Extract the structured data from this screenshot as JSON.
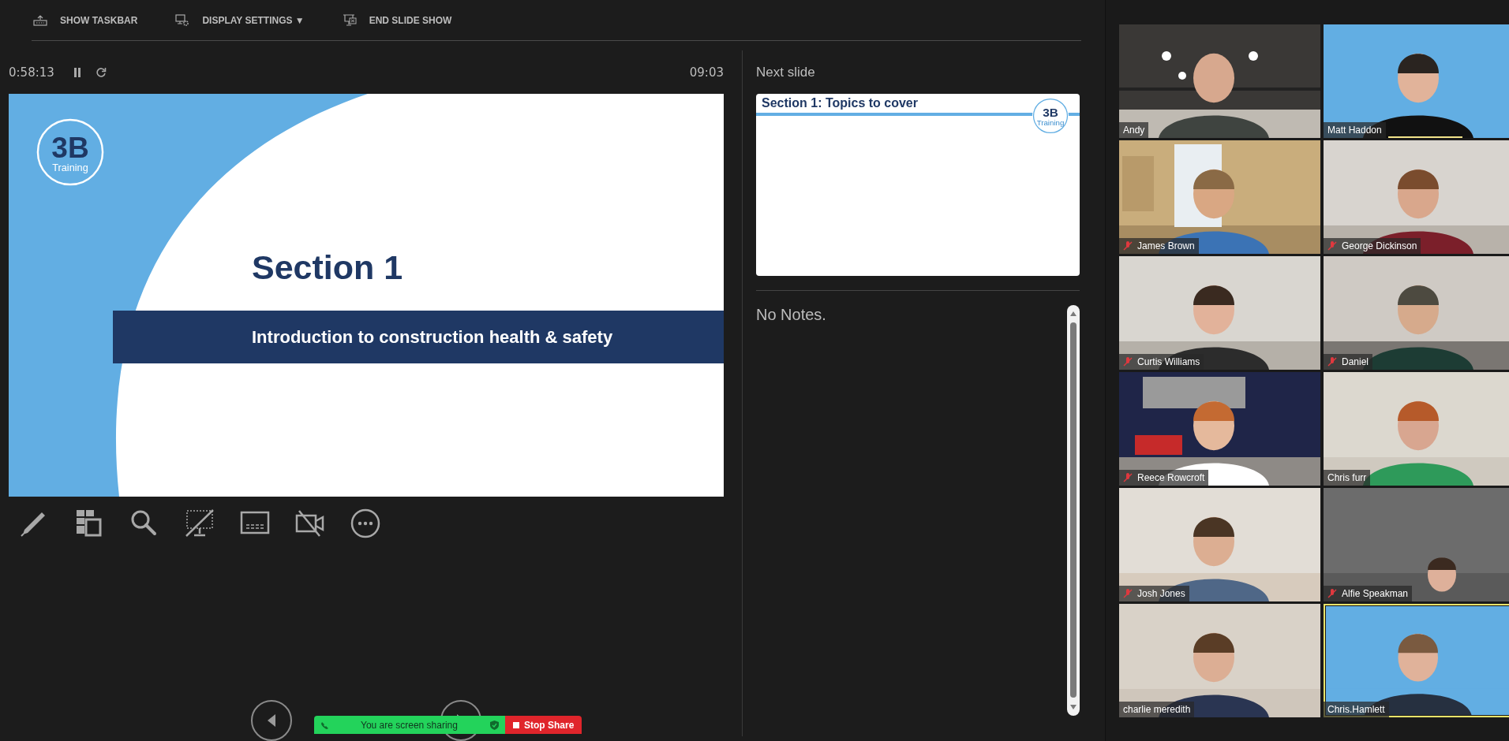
{
  "toolbar": [
    {
      "kind": "taskbar",
      "label": "SHOW TASKBAR"
    },
    {
      "kind": "display",
      "label": "DISPLAY SETTINGS ▼"
    },
    {
      "kind": "end",
      "label": "END SLIDE SHOW"
    }
  ],
  "timer": {
    "elapsed": "0:58:13",
    "clock": "09:03"
  },
  "slide": {
    "logo": {
      "mark": "3B",
      "caption": "Training"
    },
    "title": "Section 1",
    "subtitle": "Introduction to construction health & safety"
  },
  "tools": [
    {
      "kind": "pen"
    },
    {
      "kind": "slides"
    },
    {
      "kind": "zoom"
    },
    {
      "kind": "screen"
    },
    {
      "kind": "subtitles"
    },
    {
      "kind": "camera"
    },
    {
      "kind": "more"
    }
  ],
  "next_slide": {
    "heading": "Next slide",
    "title": "Section 1: Topics to cover",
    "logo": {
      "mark": "3B",
      "caption": "Training"
    }
  },
  "notes": {
    "text": "No Notes."
  },
  "share_bar": {
    "status": "You are screen sharing",
    "stop": "Stop Share"
  },
  "participants": [
    {
      "name": "Andy",
      "muted": false,
      "speaking": false,
      "selected": false
    },
    {
      "name": "Matt Haddon",
      "muted": false,
      "speaking": true,
      "selected": false
    },
    {
      "name": "James Brown",
      "muted": true,
      "speaking": false,
      "selected": false
    },
    {
      "name": "George Dickinson",
      "muted": true,
      "speaking": false,
      "selected": false
    },
    {
      "name": "Curtis Williams",
      "muted": true,
      "speaking": false,
      "selected": false
    },
    {
      "name": "Daniel",
      "muted": true,
      "speaking": false,
      "selected": false
    },
    {
      "name": "Reece Rowcroft",
      "muted": true,
      "speaking": false,
      "selected": false
    },
    {
      "name": "Chris furr",
      "muted": false,
      "speaking": false,
      "selected": false
    },
    {
      "name": "Josh Jones",
      "muted": true,
      "speaking": false,
      "selected": false
    },
    {
      "name": "Alfie Speakman",
      "muted": true,
      "speaking": false,
      "selected": false
    },
    {
      "name": "charlie meredith",
      "muted": false,
      "speaking": false,
      "selected": false
    },
    {
      "name": "Chris.Hamlett",
      "muted": false,
      "speaking": false,
      "selected": true
    }
  ]
}
